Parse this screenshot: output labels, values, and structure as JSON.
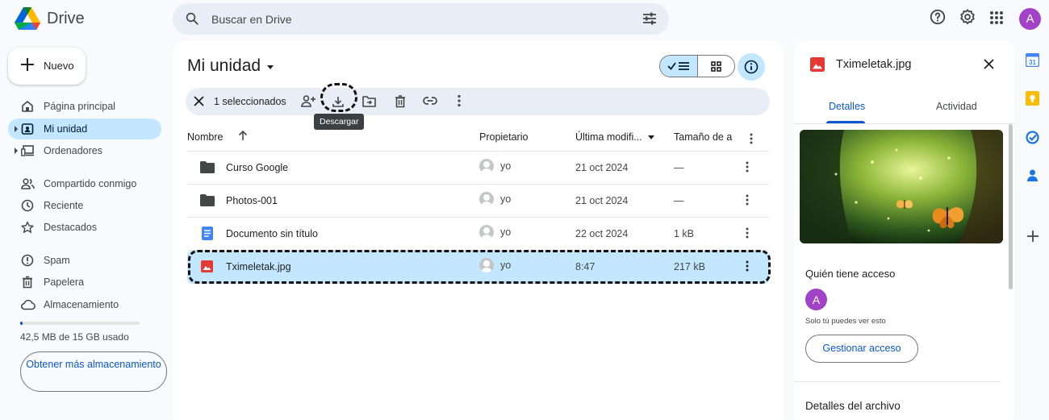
{
  "app": {
    "name": "Drive"
  },
  "search": {
    "placeholder": "Buscar en Drive"
  },
  "user": {
    "initial": "A",
    "color": "#a142c7"
  },
  "new_button": {
    "label": "Nuevo"
  },
  "sidebar": {
    "items": [
      {
        "label": "Página principal",
        "icon": "home-icon"
      },
      {
        "label": "Mi unidad",
        "icon": "my-drive-icon",
        "active": true
      },
      {
        "label": "Ordenadores",
        "icon": "computers-icon"
      },
      {
        "label": "Compartido conmigo",
        "icon": "shared-icon"
      },
      {
        "label": "Reciente",
        "icon": "clock-icon"
      },
      {
        "label": "Destacados",
        "icon": "star-icon"
      },
      {
        "label": "Spam",
        "icon": "spam-icon"
      },
      {
        "label": "Papelera",
        "icon": "trash-icon"
      },
      {
        "label": "Almacenamiento",
        "icon": "cloud-icon"
      }
    ],
    "storage_text": "42,5 MB de 15 GB usado",
    "storage_fraction": 0.003,
    "more_storage_label": "Obtener más almacenamiento"
  },
  "main": {
    "title": "Mi unidad",
    "selection_text": "1 seleccionados",
    "tooltip": "Descargar",
    "columns": {
      "name": "Nombre",
      "owner": "Propietario",
      "modified": "Última modifi...",
      "size": "Tamaño de a"
    },
    "rows": [
      {
        "name": "Curso Google",
        "owner": "yo",
        "modified": "21 oct 2024",
        "size": "—",
        "type": "folder"
      },
      {
        "name": "Photos-001",
        "owner": "yo",
        "modified": "21 oct 2024",
        "size": "—",
        "type": "folder"
      },
      {
        "name": "Documento sin título",
        "owner": "yo",
        "modified": "22 oct 2024",
        "size": "1 kB",
        "type": "doc"
      },
      {
        "name": "Tximeletak.jpg",
        "owner": "yo",
        "modified": "8:47",
        "size": "217 kB",
        "type": "image",
        "selected": true
      }
    ]
  },
  "details": {
    "file_name": "Tximeletak.jpg",
    "tabs": [
      "Detalles",
      "Actividad"
    ],
    "access_title": "Quién tiene acceso",
    "access_note": "Solo tú puedes ver esto",
    "manage_label": "Gestionar acceso",
    "file_details_title": "Detalles del archivo"
  },
  "colors": {
    "accent": "#0b57d0",
    "selected": "#c2e7ff",
    "image_red": "#e53935",
    "doc_blue": "#4285f4"
  }
}
